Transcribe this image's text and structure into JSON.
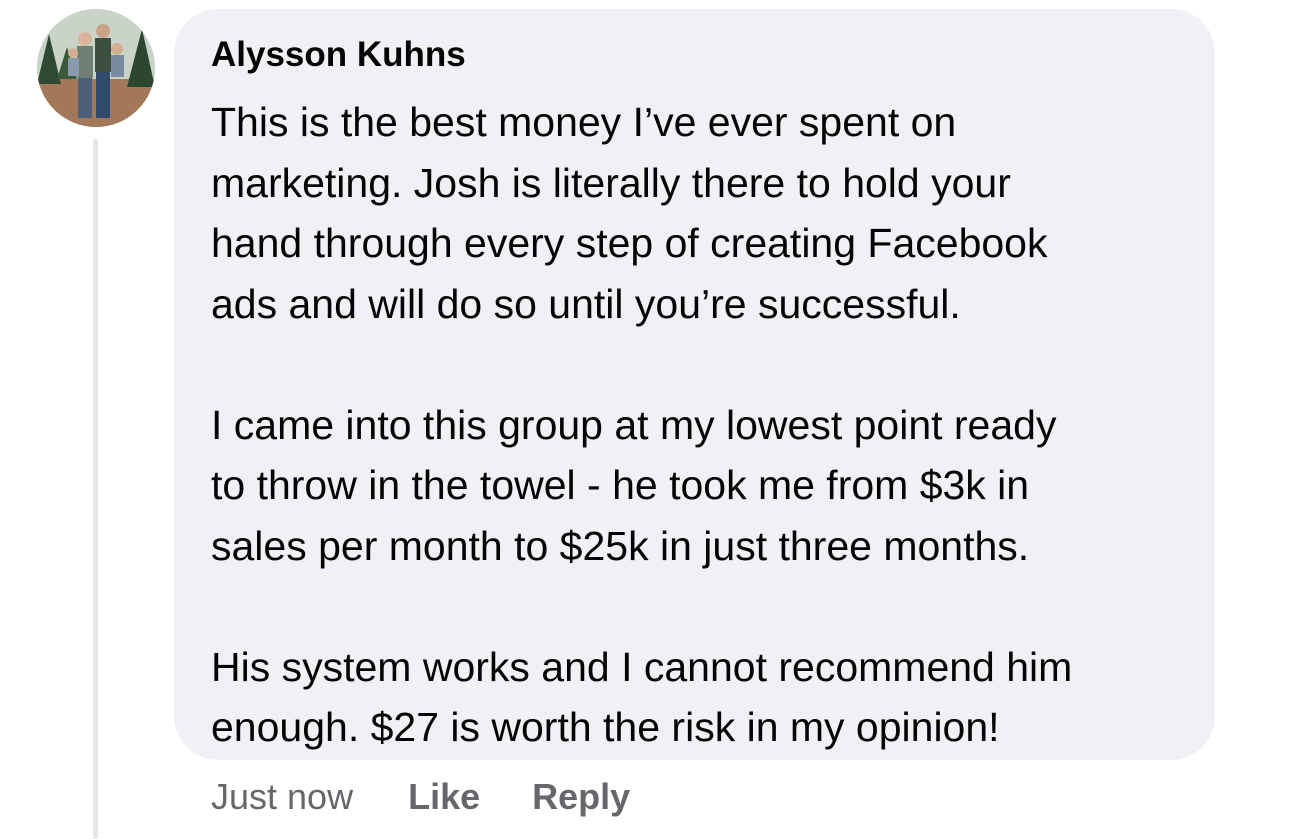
{
  "comment": {
    "author": "Alysson Kuhns",
    "paragraphs": [
      "This is the best money I’ve ever spent on\nmarketing. Josh is literally there to hold your\nhand through every step of creating Facebook\nads and will do so until you’re successful.",
      "I came into this group at my lowest point ready\nto throw in the towel - he took me from $3k in\nsales per month to $25k in just three months.",
      "His system works and I cannot recommend him\nenough. $27 is worth the risk in my opinion!"
    ],
    "timestamp": "Just now",
    "like_label": "Like",
    "reply_label": "Reply"
  },
  "colors": {
    "bubble": "#f0f1f5",
    "text": "#050505",
    "secondary_text": "#65676b",
    "thread_line": "#e4e6e9"
  }
}
